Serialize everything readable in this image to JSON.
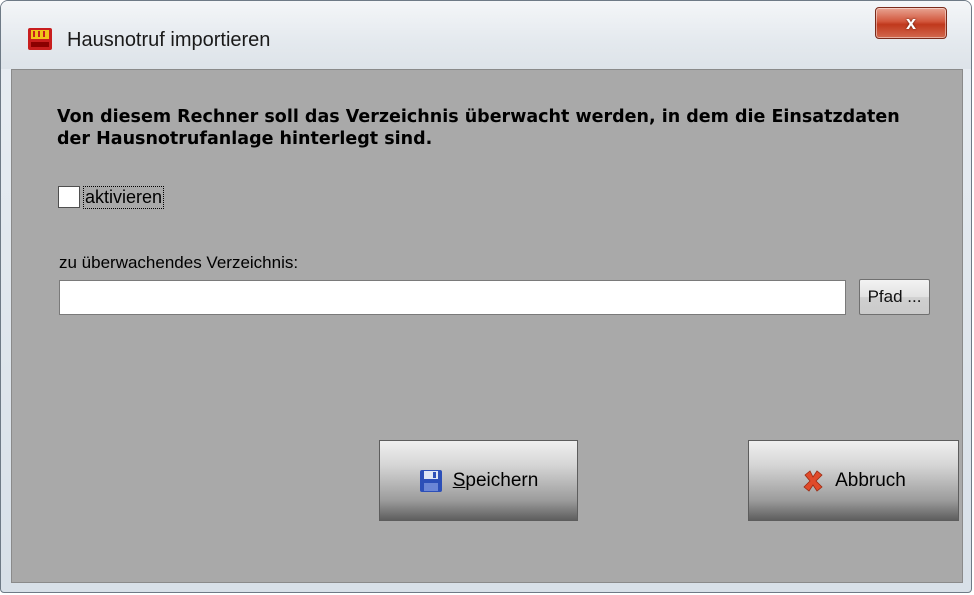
{
  "window": {
    "title": "Hausnotruf importieren",
    "close_label": "x"
  },
  "content": {
    "message": "Von diesem Rechner soll das Verzeichnis überwacht werden, in dem die Einsatzdaten der Hausnotrufanlage hinterlegt sind.",
    "activate_label": "aktivieren",
    "activate_checked": false,
    "directory_label": "zu überwachendes Verzeichnis:",
    "directory_value": "",
    "path_button_label": "Pfad ..."
  },
  "buttons": {
    "save_label": "Speichern",
    "cancel_label": "Abbruch"
  },
  "icons": {
    "app": "app-icon",
    "save": "floppy-disk-icon",
    "cancel": "red-x-icon"
  },
  "colors": {
    "client_background": "#a9a9a9",
    "close_button": "#c0381c"
  }
}
